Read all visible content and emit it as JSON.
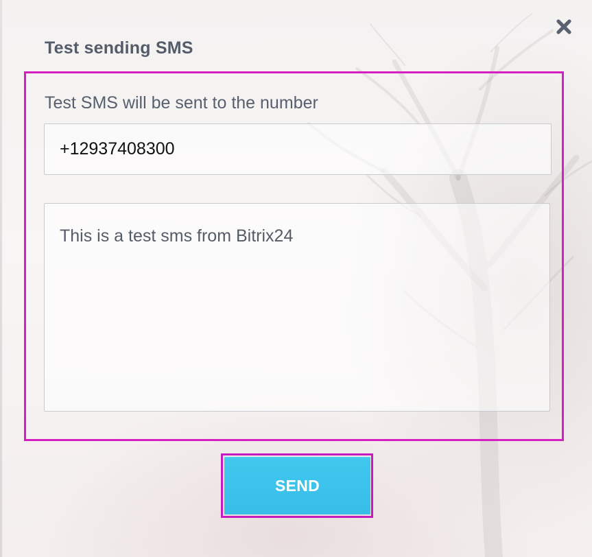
{
  "dialog": {
    "title": "Test sending SMS",
    "close_icon": "close-icon"
  },
  "form": {
    "number_label": "Test SMS will be sent to the number",
    "phone_value": "+12937408300",
    "message_value": "This is a test sms from Bitrix24"
  },
  "actions": {
    "send_label": "SEND"
  },
  "colors": {
    "title_text": "#545c6a",
    "body_text": "#56606e",
    "highlight_border": "#d61fc2",
    "send_button": "#3fc4ec",
    "send_text": "#ffffff"
  }
}
